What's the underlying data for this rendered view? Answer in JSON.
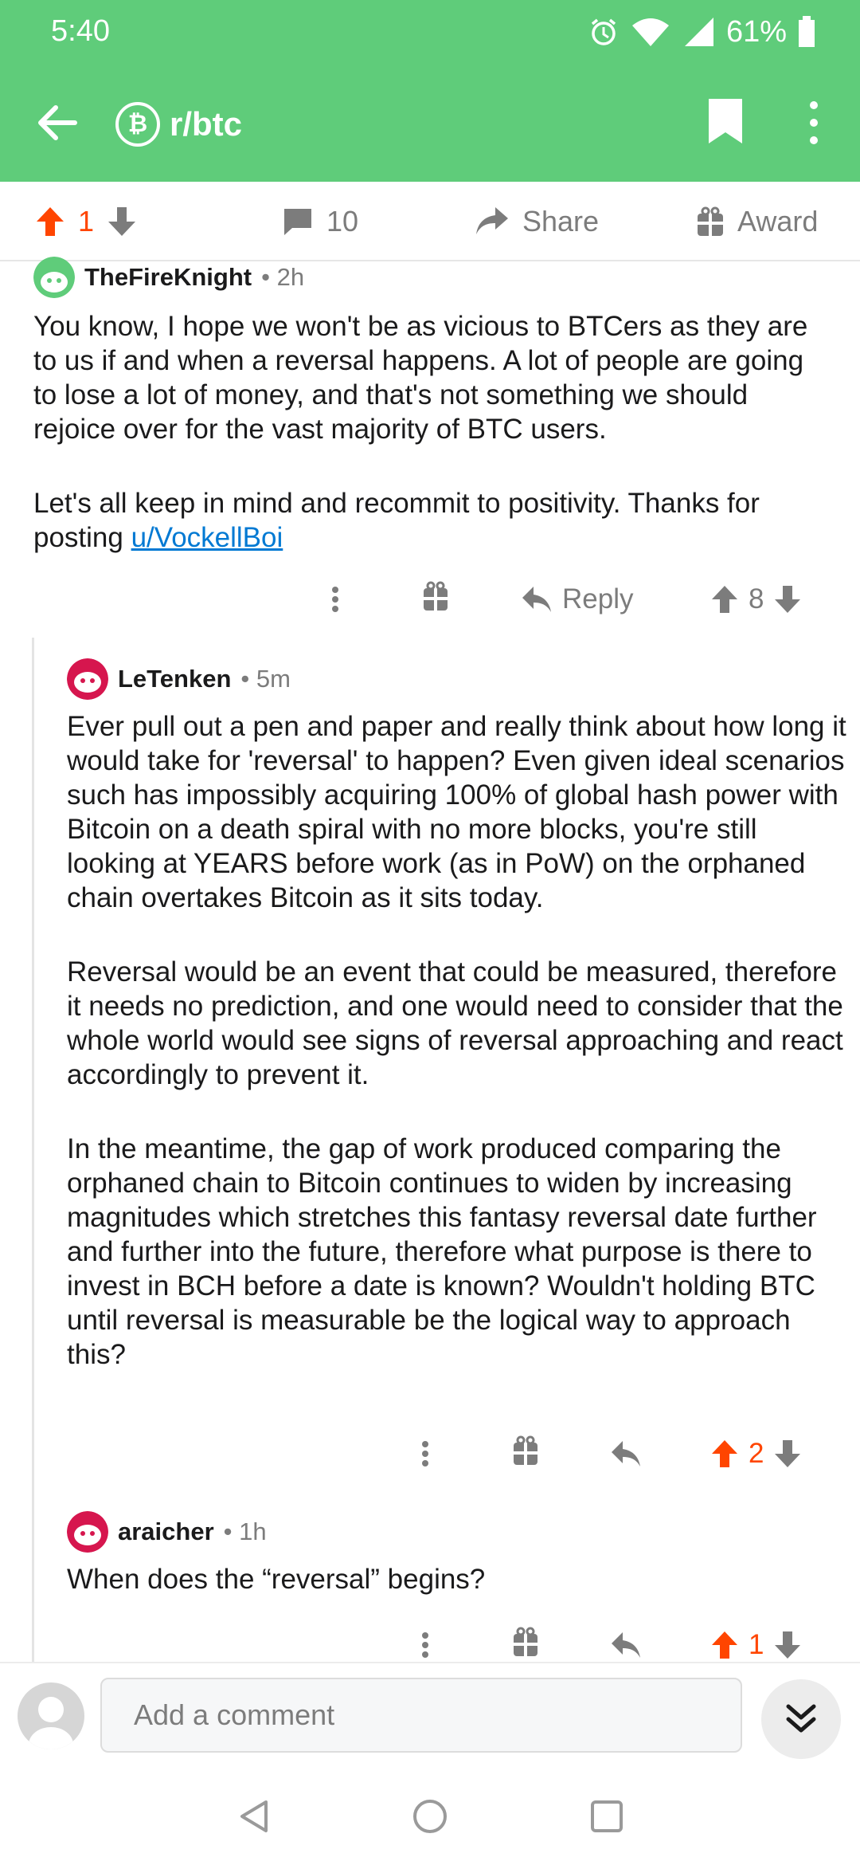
{
  "status_bar": {
    "time": "5:40",
    "battery": "61%"
  },
  "toolbar": {
    "subreddit": "r/btc",
    "coin_icon": "bitcoin-icon"
  },
  "post_actions": {
    "score": "1",
    "comments": "10",
    "share": "Share",
    "award": "Award"
  },
  "comments": [
    {
      "user": "TheFireKnight",
      "meta": "• 2h",
      "paragraphs": [
        "You know, I hope we won't be as vicious to BTCers as they are to us if and when a reversal happens. A lot of people are going to lose a lot of money, and that's not something we should rejoice over for the vast majority of BTC users."
      ],
      "last_para_prefix": "Let's all keep in mind and recommit to positivity. Thanks for posting ",
      "last_para_link": "u/VockellBoi",
      "reply_label": "Reply",
      "score": "8"
    },
    {
      "user": "LeTenken",
      "meta": "• 5m",
      "paragraphs": [
        "Ever pull out a pen and paper and really think about how long it would take for 'reversal' to happen? Even given ideal scenarios such has impossibly acquiring 100% of global hash power with Bitcoin on a death spiral with no more blocks, you're still looking at YEARS before work (as in PoW) on the orphaned chain overtakes Bitcoin as it sits today.",
        "Reversal would be an event that could be measured, therefore it needs no prediction, and one would need to consider that the whole world would see signs of reversal approaching and react accordingly to prevent it.",
        "In the meantime, the gap of work produced comparing the orphaned chain to Bitcoin continues to widen by increasing magnitudes which stretches this fantasy reversal date further and further into the future, therefore what purpose is there to invest in BCH before a date is known? Wouldn't holding BTC until reversal is measurable be the logical way to approach this?"
      ],
      "score": "2"
    },
    {
      "user": "araicher",
      "meta": "• 1h",
      "paragraphs": [
        "When does the “reversal” begins?"
      ],
      "score": "1"
    }
  ],
  "composer": {
    "placeholder": "Add a comment"
  },
  "colors": {
    "header": "#5fcc7a",
    "upvote": "#ff4500",
    "link": "#0079d3"
  }
}
